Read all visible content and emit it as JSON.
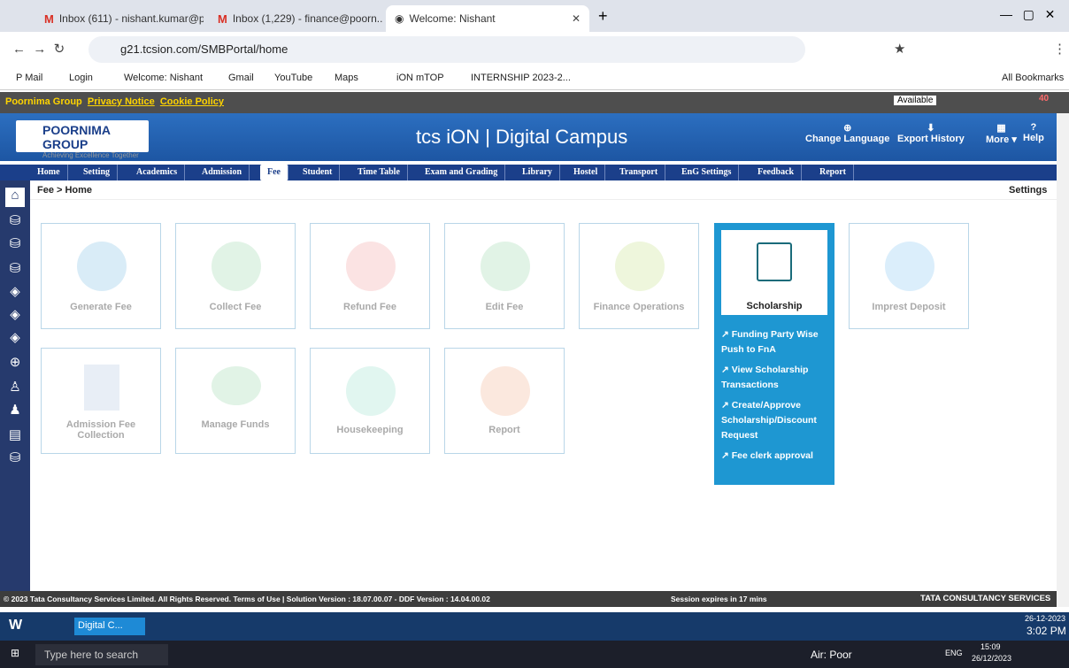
{
  "browser": {
    "tabs": [
      {
        "title": "Inbox (611) - nishant.kumar@p..."
      },
      {
        "title": "Inbox (1,229) - finance@poorn..."
      },
      {
        "title": "Welcome: Nishant"
      }
    ],
    "url": "g21.tcsion.com/SMBPortal/home",
    "bookmarks": [
      "P Mail",
      "Login",
      "Welcome: Nishant",
      "Gmail",
      "YouTube",
      "Maps",
      "iON mTOP",
      "INTERNSHIP 2023-2..."
    ],
    "all_bookmarks": "All Bookmarks"
  },
  "strip": {
    "org": "Poornima Group",
    "privacy": "Privacy Notice",
    "cookie": "Cookie Policy",
    "status": "Available",
    "notif": "40"
  },
  "header": {
    "logo": "POORNIMA GROUP",
    "tagline": "Achieving Excellence Together",
    "brand": "tcs iON | Digital Campus",
    "change_lang": "Change Language",
    "export": "Export History",
    "more": "More ▾",
    "help": "Help"
  },
  "menu": [
    "Home",
    "Setting",
    "Academics",
    "Admission",
    "Fee",
    "Student",
    "Time Table",
    "Exam and Grading",
    "Library",
    "Hostel",
    "Transport",
    "EnG Settings",
    "Feedback",
    "Report"
  ],
  "breadcrumb": "Fee > Home",
  "settings": "Settings",
  "tiles": [
    "Generate Fee",
    "Collect Fee",
    "Refund Fee",
    "Edit Fee",
    "Finance Operations",
    "Scholarship",
    "Imprest Deposit",
    "Admission Fee Collection",
    "Manage Funds",
    "Housekeeping",
    "Report"
  ],
  "scholarship_links": [
    "Funding Party Wise Push to FnA",
    "View Scholarship Transactions",
    "Create/Approve Scholarship/Discount Request",
    "Fee clerk approval"
  ],
  "footer": {
    "copy": "© 2023 Tata Consultancy Services Limited. All Rights Reserved.   Terms of Use | Solution Version : 18.07.00.07 - DDF Version : 14.04.00.02",
    "session": "Session expires in 17 mins",
    "tcs": "TATA CONSULTANCY SERVICES"
  },
  "wbar": {
    "tab": "Digital C...",
    "date": "26-12-2023",
    "time": "3:02 PM"
  },
  "taskbar": {
    "search": "Type here to search",
    "air": "Air: Poor",
    "lang": "ENG",
    "time": "15:09",
    "date": "26/12/2023"
  }
}
